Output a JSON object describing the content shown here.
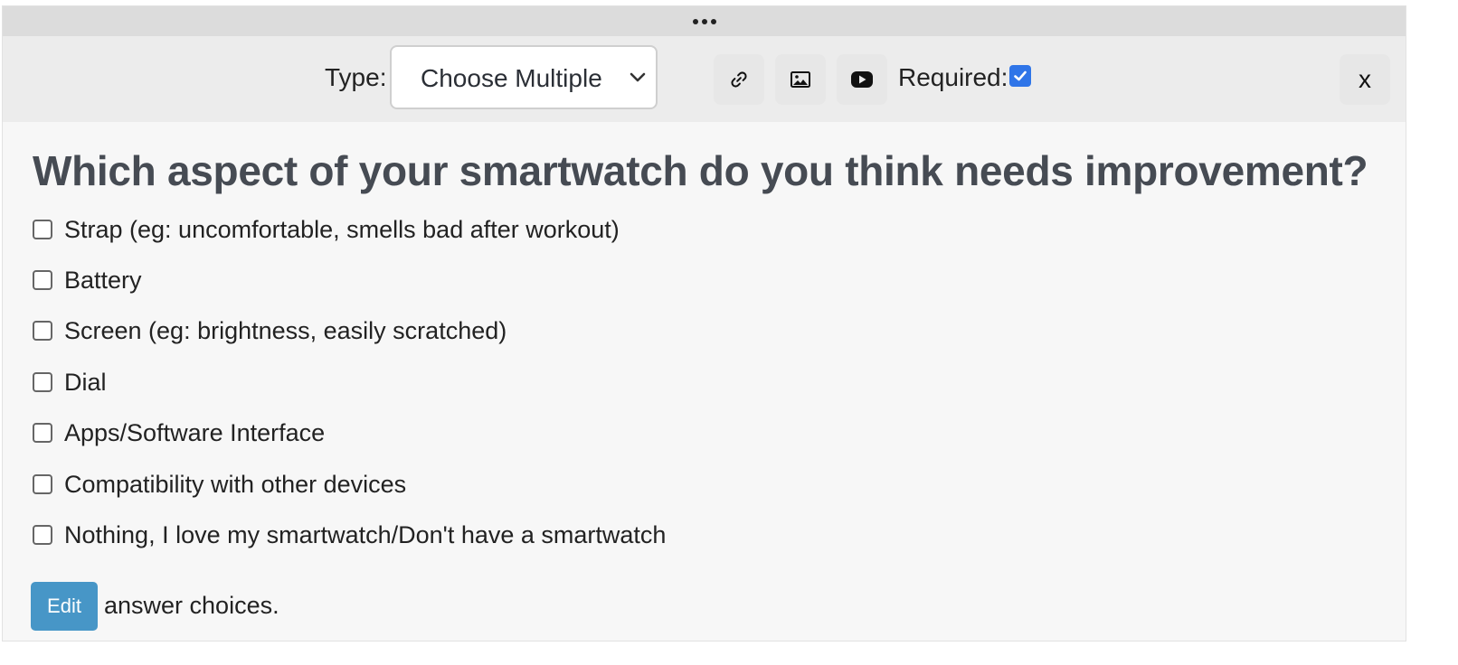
{
  "toolbar": {
    "type_label": "Type:",
    "type_value": "Choose Multiple",
    "required_label": "Required:",
    "required_checked": true,
    "close_label": "x",
    "icons": [
      "link-icon",
      "image-icon",
      "video-icon"
    ]
  },
  "question": {
    "title": "Which aspect of your smartwatch do you think needs improvement?",
    "options": [
      "Strap (eg: uncomfortable, smells bad after workout)",
      "Battery",
      "Screen (eg: brightness, easily scratched)",
      "Dial",
      "Apps/Software Interface",
      "Compatibility with other devices",
      "Nothing, I love my smartwatch/Don't have a smartwatch"
    ]
  },
  "footer": {
    "edit_label": "Edit",
    "edit_suffix": "answer choices."
  },
  "colors": {
    "accent_button": "#4796c7",
    "checkbox_checked": "#2f75e8",
    "title_text": "#464b53"
  }
}
